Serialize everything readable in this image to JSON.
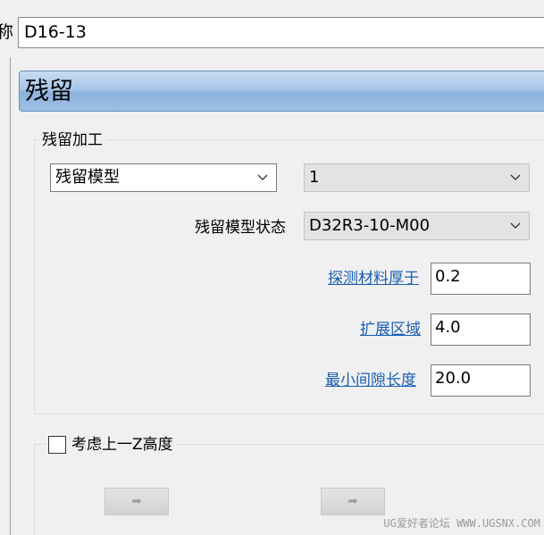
{
  "name_row": {
    "label": "称",
    "value": "D16-13"
  },
  "header": {
    "title": "残留"
  },
  "residual_group": {
    "title": "残留加工",
    "method_combo": {
      "value": "残留模型"
    },
    "index_combo": {
      "value": "1"
    },
    "model_state": {
      "label": "残留模型状态",
      "value": "D32R3-10-M00"
    },
    "detect_thickness": {
      "label": "探测材料厚于",
      "value": "0.2"
    },
    "expand_area": {
      "label": "扩展区域",
      "value": "4.0"
    },
    "min_gap_length": {
      "label": "最小间隙长度",
      "value": "20.0"
    }
  },
  "z_group": {
    "checkbox_label": "考虑上一Z高度",
    "checked": false,
    "button_left_glyph": "➡",
    "button_right_glyph": "➡"
  },
  "watermark": "UG爱好者论坛 WWW.UGSNX.COM",
  "icons": {
    "dropdown": "chevron-down-icon"
  },
  "colors": {
    "header_gradient_top": "#c7dcf2",
    "header_gradient_bottom": "#8cb2dc",
    "link": "#1a5fb4",
    "background": "#f0f0f0"
  }
}
